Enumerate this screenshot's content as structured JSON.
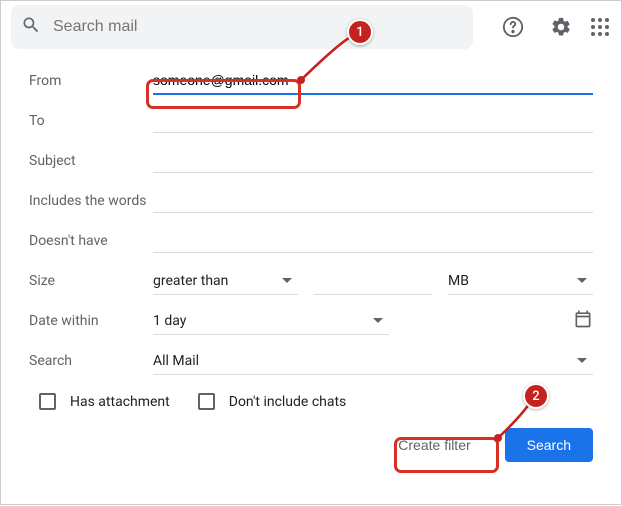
{
  "header": {
    "search_placeholder": "Search mail"
  },
  "filter": {
    "from_label": "From",
    "from_value": "someone@gmail.com",
    "to_label": "To",
    "subject_label": "Subject",
    "includes_label": "Includes the words",
    "doesnt_have_label": "Doesn't have",
    "size_label": "Size",
    "size_op": "greater than",
    "size_unit": "MB",
    "date_label": "Date within",
    "date_value": "1 day",
    "search_label": "Search",
    "search_value": "All Mail",
    "has_attachment": "Has attachment",
    "no_chats": "Don't include chats"
  },
  "buttons": {
    "create_filter": "Create filter",
    "search": "Search"
  },
  "callouts": {
    "one": "1",
    "two": "2"
  }
}
